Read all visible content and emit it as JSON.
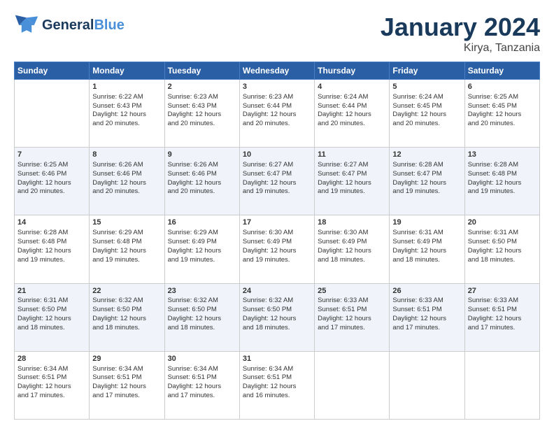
{
  "header": {
    "logo_line1": "General",
    "logo_line2": "Blue",
    "month_title": "January 2024",
    "location": "Kirya, Tanzania"
  },
  "days_of_week": [
    "Sunday",
    "Monday",
    "Tuesday",
    "Wednesday",
    "Thursday",
    "Friday",
    "Saturday"
  ],
  "weeks": [
    [
      {
        "day": "",
        "sunrise": "",
        "sunset": "",
        "daylight": ""
      },
      {
        "day": "1",
        "sunrise": "Sunrise: 6:22 AM",
        "sunset": "Sunset: 6:43 PM",
        "daylight": "Daylight: 12 hours and 20 minutes."
      },
      {
        "day": "2",
        "sunrise": "Sunrise: 6:23 AM",
        "sunset": "Sunset: 6:43 PM",
        "daylight": "Daylight: 12 hours and 20 minutes."
      },
      {
        "day": "3",
        "sunrise": "Sunrise: 6:23 AM",
        "sunset": "Sunset: 6:44 PM",
        "daylight": "Daylight: 12 hours and 20 minutes."
      },
      {
        "day": "4",
        "sunrise": "Sunrise: 6:24 AM",
        "sunset": "Sunset: 6:44 PM",
        "daylight": "Daylight: 12 hours and 20 minutes."
      },
      {
        "day": "5",
        "sunrise": "Sunrise: 6:24 AM",
        "sunset": "Sunset: 6:45 PM",
        "daylight": "Daylight: 12 hours and 20 minutes."
      },
      {
        "day": "6",
        "sunrise": "Sunrise: 6:25 AM",
        "sunset": "Sunset: 6:45 PM",
        "daylight": "Daylight: 12 hours and 20 minutes."
      }
    ],
    [
      {
        "day": "7",
        "sunrise": "Sunrise: 6:25 AM",
        "sunset": "Sunset: 6:46 PM",
        "daylight": "Daylight: 12 hours and 20 minutes."
      },
      {
        "day": "8",
        "sunrise": "Sunrise: 6:26 AM",
        "sunset": "Sunset: 6:46 PM",
        "daylight": "Daylight: 12 hours and 20 minutes."
      },
      {
        "day": "9",
        "sunrise": "Sunrise: 6:26 AM",
        "sunset": "Sunset: 6:46 PM",
        "daylight": "Daylight: 12 hours and 20 minutes."
      },
      {
        "day": "10",
        "sunrise": "Sunrise: 6:27 AM",
        "sunset": "Sunset: 6:47 PM",
        "daylight": "Daylight: 12 hours and 19 minutes."
      },
      {
        "day": "11",
        "sunrise": "Sunrise: 6:27 AM",
        "sunset": "Sunset: 6:47 PM",
        "daylight": "Daylight: 12 hours and 19 minutes."
      },
      {
        "day": "12",
        "sunrise": "Sunrise: 6:28 AM",
        "sunset": "Sunset: 6:47 PM",
        "daylight": "Daylight: 12 hours and 19 minutes."
      },
      {
        "day": "13",
        "sunrise": "Sunrise: 6:28 AM",
        "sunset": "Sunset: 6:48 PM",
        "daylight": "Daylight: 12 hours and 19 minutes."
      }
    ],
    [
      {
        "day": "14",
        "sunrise": "Sunrise: 6:28 AM",
        "sunset": "Sunset: 6:48 PM",
        "daylight": "Daylight: 12 hours and 19 minutes."
      },
      {
        "day": "15",
        "sunrise": "Sunrise: 6:29 AM",
        "sunset": "Sunset: 6:48 PM",
        "daylight": "Daylight: 12 hours and 19 minutes."
      },
      {
        "day": "16",
        "sunrise": "Sunrise: 6:29 AM",
        "sunset": "Sunset: 6:49 PM",
        "daylight": "Daylight: 12 hours and 19 minutes."
      },
      {
        "day": "17",
        "sunrise": "Sunrise: 6:30 AM",
        "sunset": "Sunset: 6:49 PM",
        "daylight": "Daylight: 12 hours and 19 minutes."
      },
      {
        "day": "18",
        "sunrise": "Sunrise: 6:30 AM",
        "sunset": "Sunset: 6:49 PM",
        "daylight": "Daylight: 12 hours and 18 minutes."
      },
      {
        "day": "19",
        "sunrise": "Sunrise: 6:31 AM",
        "sunset": "Sunset: 6:49 PM",
        "daylight": "Daylight: 12 hours and 18 minutes."
      },
      {
        "day": "20",
        "sunrise": "Sunrise: 6:31 AM",
        "sunset": "Sunset: 6:50 PM",
        "daylight": "Daylight: 12 hours and 18 minutes."
      }
    ],
    [
      {
        "day": "21",
        "sunrise": "Sunrise: 6:31 AM",
        "sunset": "Sunset: 6:50 PM",
        "daylight": "Daylight: 12 hours and 18 minutes."
      },
      {
        "day": "22",
        "sunrise": "Sunrise: 6:32 AM",
        "sunset": "Sunset: 6:50 PM",
        "daylight": "Daylight: 12 hours and 18 minutes."
      },
      {
        "day": "23",
        "sunrise": "Sunrise: 6:32 AM",
        "sunset": "Sunset: 6:50 PM",
        "daylight": "Daylight: 12 hours and 18 minutes."
      },
      {
        "day": "24",
        "sunrise": "Sunrise: 6:32 AM",
        "sunset": "Sunset: 6:50 PM",
        "daylight": "Daylight: 12 hours and 18 minutes."
      },
      {
        "day": "25",
        "sunrise": "Sunrise: 6:33 AM",
        "sunset": "Sunset: 6:51 PM",
        "daylight": "Daylight: 12 hours and 17 minutes."
      },
      {
        "day": "26",
        "sunrise": "Sunrise: 6:33 AM",
        "sunset": "Sunset: 6:51 PM",
        "daylight": "Daylight: 12 hours and 17 minutes."
      },
      {
        "day": "27",
        "sunrise": "Sunrise: 6:33 AM",
        "sunset": "Sunset: 6:51 PM",
        "daylight": "Daylight: 12 hours and 17 minutes."
      }
    ],
    [
      {
        "day": "28",
        "sunrise": "Sunrise: 6:34 AM",
        "sunset": "Sunset: 6:51 PM",
        "daylight": "Daylight: 12 hours and 17 minutes."
      },
      {
        "day": "29",
        "sunrise": "Sunrise: 6:34 AM",
        "sunset": "Sunset: 6:51 PM",
        "daylight": "Daylight: 12 hours and 17 minutes."
      },
      {
        "day": "30",
        "sunrise": "Sunrise: 6:34 AM",
        "sunset": "Sunset: 6:51 PM",
        "daylight": "Daylight: 12 hours and 17 minutes."
      },
      {
        "day": "31",
        "sunrise": "Sunrise: 6:34 AM",
        "sunset": "Sunset: 6:51 PM",
        "daylight": "Daylight: 12 hours and 16 minutes."
      },
      {
        "day": "",
        "sunrise": "",
        "sunset": "",
        "daylight": ""
      },
      {
        "day": "",
        "sunrise": "",
        "sunset": "",
        "daylight": ""
      },
      {
        "day": "",
        "sunrise": "",
        "sunset": "",
        "daylight": ""
      }
    ]
  ]
}
